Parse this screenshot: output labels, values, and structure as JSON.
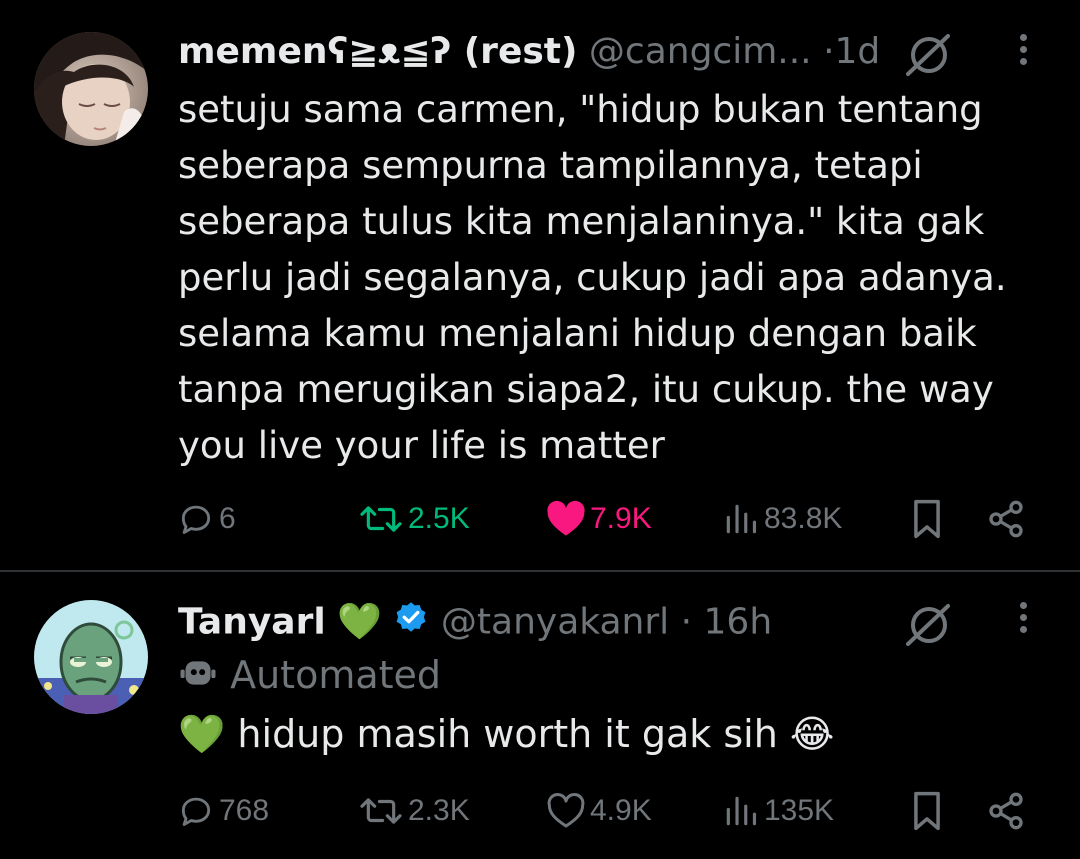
{
  "tweets": [
    {
      "author": {
        "name": "memenʕ≧ᴥ≦ʔ (rest)",
        "handle": "@cangcim...",
        "separator": "·",
        "time": "1d",
        "verified": false,
        "avatar_icon": "profile-photo"
      },
      "text": "setuju sama carmen, \"hidup bukan tentang seberapa sempurna tampilannya, tetapi seberapa tulus kita menjalaninya.\" kita gak perlu jadi segalanya, cukup jadi apa adanya. selama kamu menjalani hidup dengan baik tanpa merugikan siapa2, itu cukup. the way you live your life is matter",
      "actions": {
        "replies": "6",
        "reposts": "2.5K",
        "likes": "7.9K",
        "views": "83.8K"
      },
      "state": {
        "reposted": true,
        "liked": true
      }
    },
    {
      "author": {
        "name": "Tanyarl",
        "name_emoji": "💚",
        "handle": "@tanyakanrl",
        "separator": "·",
        "time": "16h",
        "verified": true,
        "avatar_icon": "spongebob-fish-avatar"
      },
      "automated_label": "Automated",
      "text_prefix_emoji": "💚",
      "text": "hidup masih worth it gak sih",
      "text_suffix_emoji": "😂",
      "actions": {
        "replies": "768",
        "reposts": "2.3K",
        "likes": "4.9K",
        "views": "135K"
      },
      "state": {
        "reposted": false,
        "liked": false
      }
    }
  ],
  "colors": {
    "background": "#000000",
    "text": "#e7e9ea",
    "muted": "#71767b",
    "repost_active": "#00ba7c",
    "like_active": "#f91880",
    "verified": "#1d9bf0",
    "divider": "#2f3336"
  }
}
